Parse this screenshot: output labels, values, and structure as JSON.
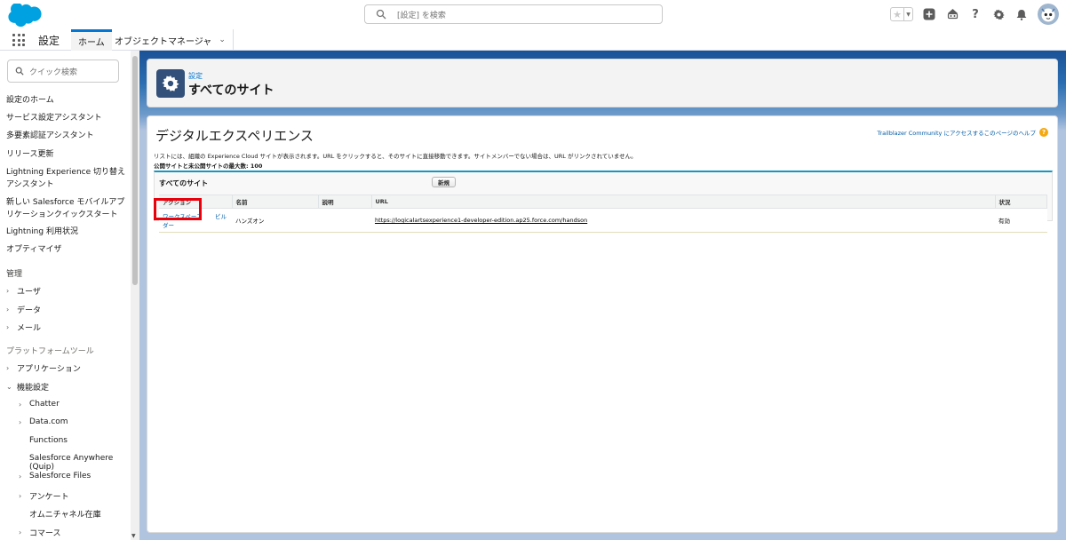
{
  "header": {
    "search_placeholder": "[設定] を検索",
    "colors": {
      "brand": "#00a1e0",
      "accent": "#0176d3"
    },
    "icons": [
      "favorites-star-icon",
      "add-icon",
      "trailhead-icon",
      "help-icon",
      "gear-icon",
      "bell-icon",
      "avatar"
    ]
  },
  "nav": {
    "app_name": "設定",
    "tabs": [
      {
        "label": "ホーム",
        "active": true
      },
      {
        "label": "オブジェクトマネージャ",
        "active": false
      }
    ]
  },
  "sidebar": {
    "search_placeholder": "クイック検索",
    "items": [
      "設定のホーム",
      "サービス設定アシスタント",
      "多要素認証アシスタント",
      "リリース更新",
      "Lightning Experience 切り替えアシスタント",
      "新しい Salesforce モバイルアプリケーションクイックスタート",
      "Lightning 利用状況",
      "オプティマイザ"
    ],
    "section_admin": "管理",
    "admin_items": [
      "ユーザ",
      "データ",
      "メール"
    ],
    "section_platform": "プラットフォームツール",
    "platform_items": [
      "アプリケーション",
      "機能設定"
    ],
    "feature_items": [
      {
        "label": "Chatter",
        "expandable": true
      },
      {
        "label": "Data.com",
        "expandable": true
      },
      {
        "label": "Functions",
        "expandable": false
      },
      {
        "label": "Salesforce Anywhere (Quip)",
        "expandable": false
      },
      {
        "label": "Salesforce Files",
        "expandable": true
      },
      {
        "label": "アンケート",
        "expandable": true
      },
      {
        "label": "オムニチャネル在庫",
        "expandable": false
      },
      {
        "label": "コマース",
        "expandable": true
      }
    ]
  },
  "page_header": {
    "breadcrumb": "設定",
    "title": "すべてのサイト"
  },
  "main": {
    "title": "デジタルエクスペリエンス",
    "help_link": "Trailblazer Community にアクセスするこのページのヘルプ",
    "description": "リストには、組織の Experience Cloud サイトが表示されます。URL をクリックすると、そのサイトに直接移動できます。サイトメンバーでない場合は、URL がリンクされていません。",
    "limit_text": "公開サイトと未公開サイトの最大数: 100",
    "sites_title": "すべてのサイト",
    "new_button": "新規",
    "table": {
      "headers": [
        "アクション",
        "名前",
        "説明",
        "URL",
        "状況"
      ],
      "rows": [
        {
          "action_workspace": "ワークスペース",
          "action_builder": "ビルダー",
          "name": "ハンズオン",
          "description": "",
          "url": "https://logicalartsexperience1-developer-edition.ap25.force.com/handson",
          "status": "有効"
        }
      ]
    }
  }
}
